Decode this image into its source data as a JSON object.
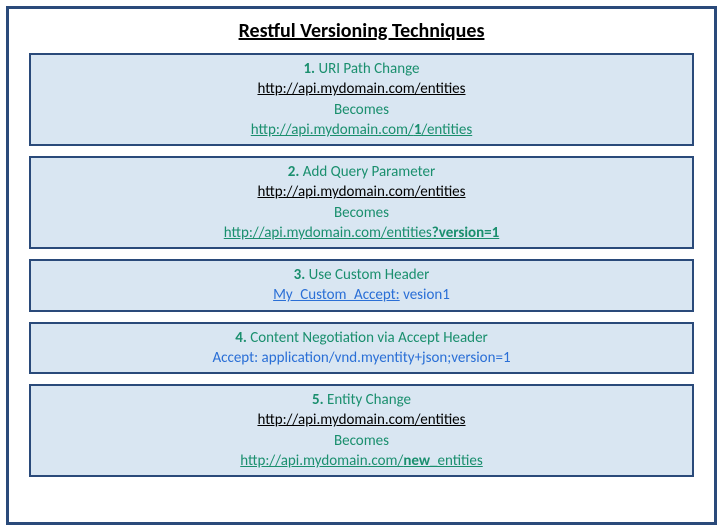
{
  "title": "Restful Versioning  Techniques",
  "items": [
    {
      "num": "1.",
      "label": "URI Path Change",
      "original": "http://api.mydomain.com/entities",
      "becomes": "Becomes",
      "result_pre": "http://api.mydomain.com/",
      "result_bold": "1",
      "result_post": "/entities"
    },
    {
      "num": "2.",
      "label": "Add Query Parameter",
      "original": "http://api.mydomain.com/entities",
      "becomes": "Becomes",
      "result_pre": "http://api.mydomain.com/entities",
      "result_bold": "?version=1",
      "result_post": ""
    },
    {
      "num": "3.",
      "label": "Use Custom Header",
      "header_name": "My_Custom_Accept:",
      "header_val": " vesion1"
    },
    {
      "num": "4.",
      "label": "Content Negotiation via Accept Header",
      "header_line": "Accept: application/vnd.myentity+json;version=1"
    },
    {
      "num": "5.",
      "label": "Entity Change",
      "original": "http://api.mydomain.com/entities",
      "becomes": "Becomes",
      "result_pre": "http://api.mydomain.com/",
      "result_bold": "new_",
      "result_post": "entities"
    }
  ]
}
